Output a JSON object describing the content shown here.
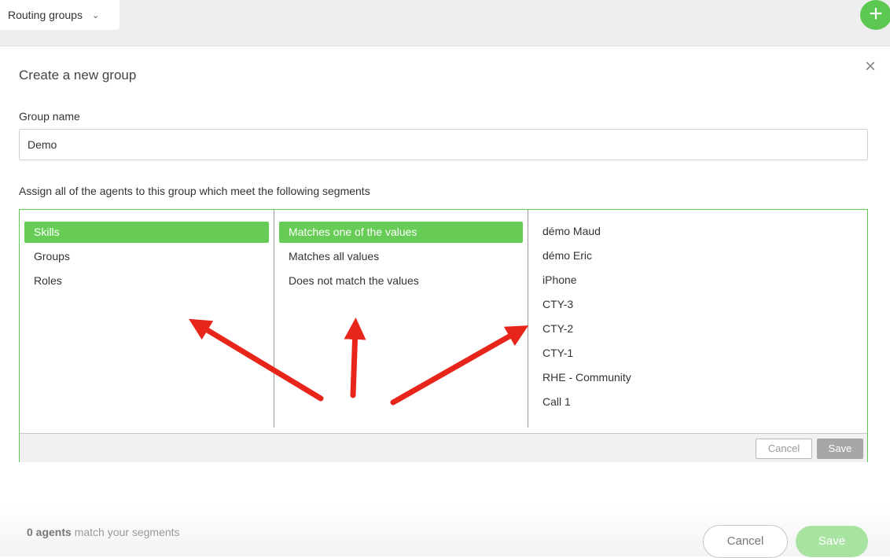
{
  "topbar": {
    "dropdown_label": "Routing groups",
    "dropdown_icon": "chevron-down-icon",
    "add_icon": "plus-icon",
    "add_color": "#5cc851"
  },
  "dialog": {
    "title": "Create a new group",
    "close_icon": "close-icon",
    "group_name_label": "Group name",
    "group_name_value": "Demo",
    "assign_label": "Assign all of the agents to this group which meet the following segments"
  },
  "segments": {
    "categories": [
      {
        "label": "Skills",
        "selected": true
      },
      {
        "label": "Groups",
        "selected": false
      },
      {
        "label": "Roles",
        "selected": false
      }
    ],
    "operators": [
      {
        "label": "Matches one of the values",
        "selected": true
      },
      {
        "label": "Matches all values",
        "selected": false
      },
      {
        "label": "Does not match the values",
        "selected": false
      }
    ],
    "values": [
      "démo Maud",
      "démo Eric",
      "iPhone",
      "CTY-3",
      "CTY-2",
      "CTY-1",
      "RHE - Community",
      "Call 1"
    ],
    "cancel_label": "Cancel",
    "save_label": "Save",
    "accent": "#5cc851",
    "selected_bg": "#66cc55"
  },
  "footer": {
    "match_count": "0 agents",
    "match_suffix": "match your segments",
    "cancel_label": "Cancel",
    "save_label": "Save"
  },
  "annotations": {
    "arrow_color": "#e8251a"
  }
}
